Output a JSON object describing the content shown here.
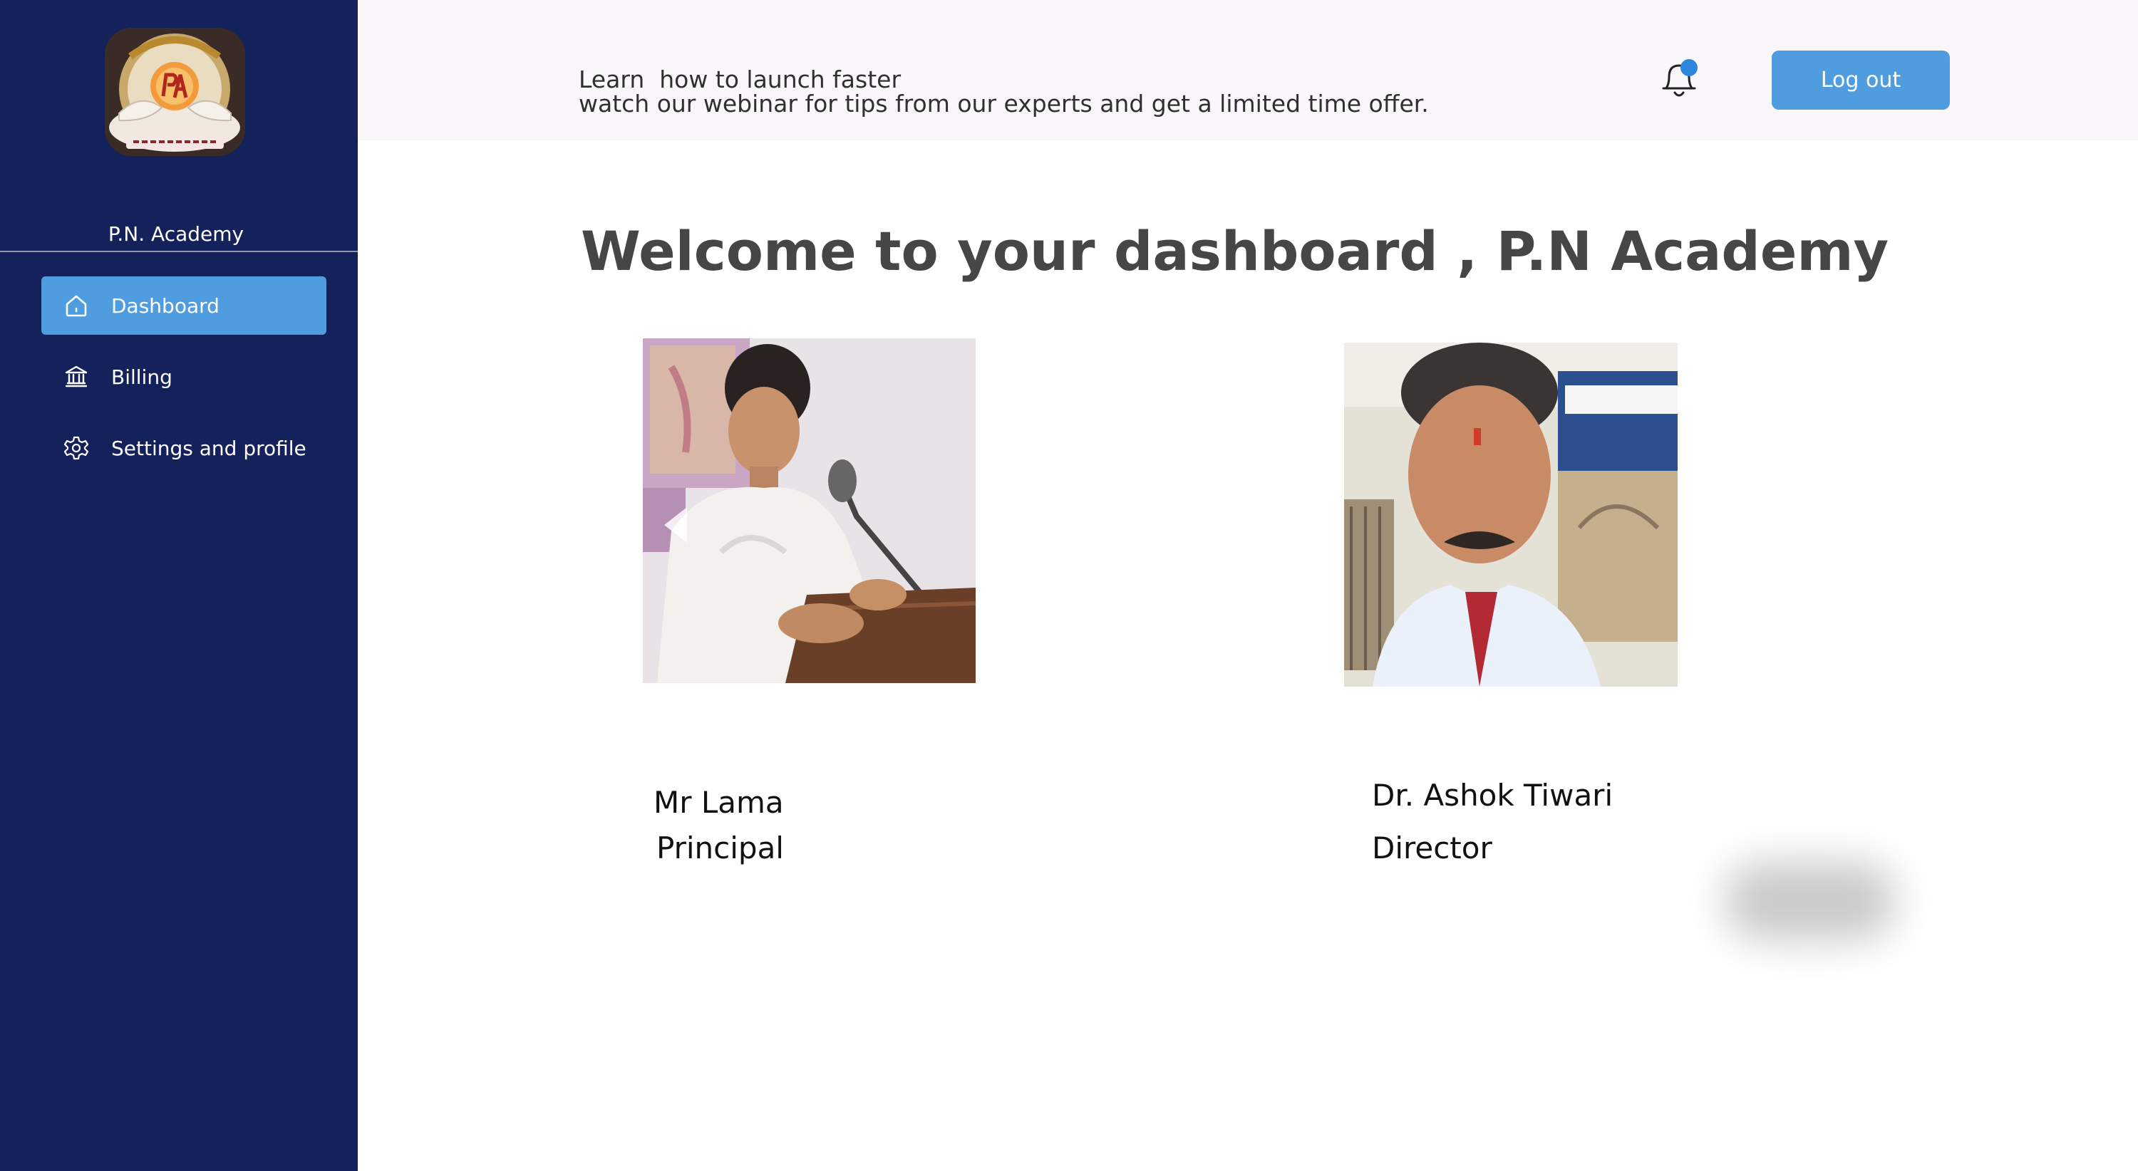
{
  "sidebar": {
    "org_name": "P.N. Academy",
    "logo_icon": "academy-emblem",
    "items": [
      {
        "label": "Dashboard",
        "icon": "home-icon",
        "active": true
      },
      {
        "label": "Billing",
        "icon": "bank-icon",
        "active": false
      },
      {
        "label": "Settings and profile",
        "icon": "gear-icon",
        "active": false
      }
    ]
  },
  "header": {
    "promo_title": "Learn  how to launch faster",
    "promo_subtitle": "watch our webinar for tips from our experts and get a limited time offer.",
    "notification_icon": "bell-icon",
    "logout_label": "Log out"
  },
  "main": {
    "welcome": "Welcome to your dashboard , P.N Academy",
    "people": [
      {
        "name": "Mr Lama",
        "role": "Principal"
      },
      {
        "name": "Dr. Ashok Tiwari",
        "role": "Director"
      }
    ]
  },
  "colors": {
    "sidebar_bg": "#14215a",
    "accent": "#4f9ddf",
    "topbar_bg": "#f9f7f9",
    "heading": "#464646",
    "notification_dot": "#2f86dd"
  }
}
